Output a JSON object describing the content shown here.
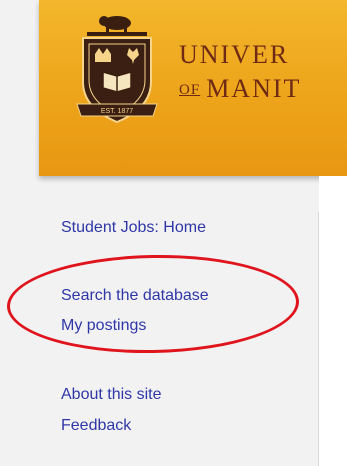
{
  "header": {
    "crest_year": "EST. 1877",
    "name_line1": "Univer",
    "name_of": "of",
    "name_line2": "Manit"
  },
  "nav": {
    "home": "Student Jobs: Home",
    "search": "Search the database",
    "postings": "My postings",
    "about": "About this site",
    "feedback": "Feedback"
  },
  "colors": {
    "header_gold": "#eda41a",
    "name_brown": "#6e2a14",
    "link_blue": "#2f37a8",
    "highlight_red": "#e0141c"
  },
  "icons": [
    "university-crest-icon"
  ]
}
